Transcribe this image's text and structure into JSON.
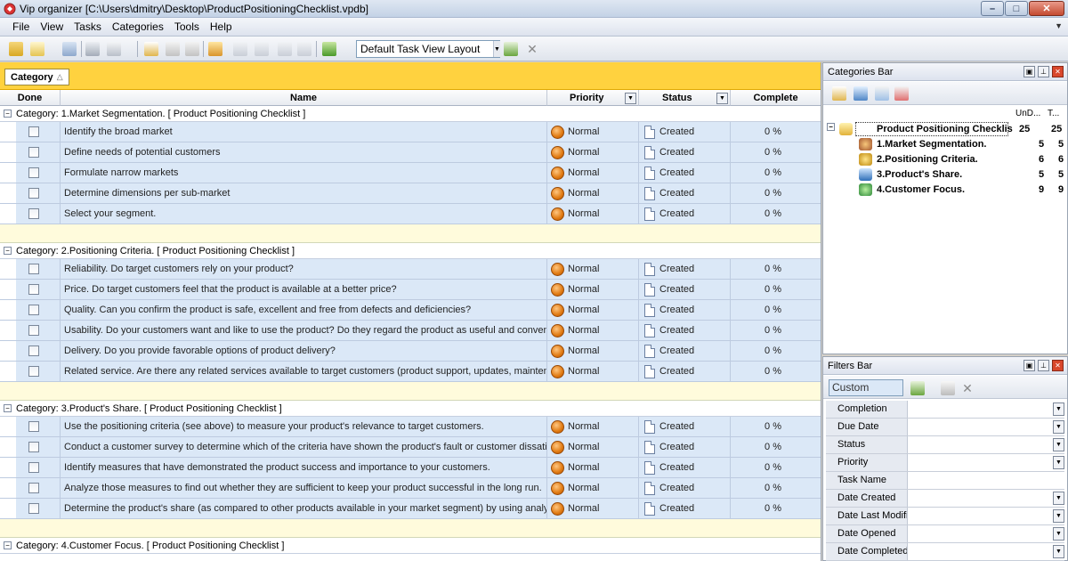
{
  "window": {
    "title": "Vip organizer [C:\\Users\\dmitry\\Desktop\\ProductPositioningChecklist.vpdb]",
    "minimize": "–",
    "maximize": "□",
    "close": "✕"
  },
  "menu": [
    "File",
    "View",
    "Tasks",
    "Categories",
    "Tools",
    "Help"
  ],
  "toolbar": {
    "layout_select": "Default Task View Layout"
  },
  "grid": {
    "group_by": "Category",
    "group_sort": "△",
    "columns": {
      "done": "Done",
      "name": "Name",
      "priority": "Priority",
      "status": "Status",
      "complete": "Complete"
    },
    "groups": [
      {
        "label": "Category: 1.Market Segmentation.    [ Product Positioning Checklist ]",
        "tasks": [
          {
            "name": "Identify the broad market",
            "priority": "Normal",
            "status": "Created",
            "complete": "0 %"
          },
          {
            "name": "Define needs of potential customers",
            "priority": "Normal",
            "status": "Created",
            "complete": "0 %"
          },
          {
            "name": "Formulate narrow markets",
            "priority": "Normal",
            "status": "Created",
            "complete": "0 %"
          },
          {
            "name": "Determine dimensions per sub-market",
            "priority": "Normal",
            "status": "Created",
            "complete": "0 %"
          },
          {
            "name": "Select your segment.",
            "priority": "Normal",
            "status": "Created",
            "complete": "0 %"
          }
        ]
      },
      {
        "label": "Category: 2.Positioning Criteria.    [ Product Positioning Checklist ]",
        "tasks": [
          {
            "name": "Reliability. Do target customers rely on your product?",
            "priority": "Normal",
            "status": "Created",
            "complete": "0 %"
          },
          {
            "name": "Price. Do target customers feel that the product is available at a better price?",
            "priority": "Normal",
            "status": "Created",
            "complete": "0 %"
          },
          {
            "name": "Quality. Can you confirm the product is safe, excellent and free from defects and deficiencies?",
            "priority": "Normal",
            "status": "Created",
            "complete": "0 %"
          },
          {
            "name": "Usability. Do your customers want and like to use the product? Do they regard the product as useful and convenient?",
            "priority": "Normal",
            "status": "Created",
            "complete": "0 %"
          },
          {
            "name": "Delivery. Do you provide favorable options of product delivery?",
            "priority": "Normal",
            "status": "Created",
            "complete": "0 %"
          },
          {
            "name": "Related service. Are there any related services available to target customers (product support, updates, maintenance)?",
            "priority": "Normal",
            "status": "Created",
            "complete": "0 %"
          }
        ]
      },
      {
        "label": "Category: 3.Product's Share.    [ Product Positioning Checklist ]",
        "tasks": [
          {
            "name": "Use the positioning criteria (see above) to measure your product's relevance to target customers.",
            "priority": "Normal",
            "status": "Created",
            "complete": "0 %"
          },
          {
            "name": "Conduct a customer survey to determine which of the criteria have shown the product's fault or customer dissatisfaction.",
            "priority": "Normal",
            "status": "Created",
            "complete": "0 %"
          },
          {
            "name": "Identify measures that have demonstrated the product success and importance to your customers.",
            "priority": "Normal",
            "status": "Created",
            "complete": "0 %"
          },
          {
            "name": "Analyze those measures to find out whether they are sufficient to keep your product successful in the long run.",
            "priority": "Normal",
            "status": "Created",
            "complete": "0 %"
          },
          {
            "name": "Determine the product's share (as compared to other products available in your market segment) by using analysis results.",
            "priority": "Normal",
            "status": "Created",
            "complete": "0 %"
          }
        ]
      },
      {
        "label": "Category: 4.Customer Focus.    [ Product Positioning Checklist ]",
        "tasks": []
      }
    ]
  },
  "categories_bar": {
    "title": "Categories Bar",
    "col_undone": "UnD...",
    "col_total": "T...",
    "root": {
      "name": "Product Positioning Checklis",
      "undone": "25",
      "total": "25"
    },
    "items": [
      {
        "name": "1.Market Segmentation.",
        "undone": "5",
        "total": "5"
      },
      {
        "name": "2.Positioning Criteria.",
        "undone": "6",
        "total": "6"
      },
      {
        "name": "3.Product's Share.",
        "undone": "5",
        "total": "5"
      },
      {
        "name": "4.Customer Focus.",
        "undone": "9",
        "total": "9"
      }
    ]
  },
  "filters_bar": {
    "title": "Filters Bar",
    "preset": "Custom",
    "filters": [
      "Completion",
      "Due Date",
      "Status",
      "Priority",
      "Task Name",
      "Date Created",
      "Date Last Modifie",
      "Date Opened",
      "Date Completed"
    ]
  },
  "colors": {
    "group_panel": "#ffd23f",
    "row_bg": "#dbe8f7",
    "spacer_bg": "#fffbdc",
    "priority": "#e07a12"
  }
}
